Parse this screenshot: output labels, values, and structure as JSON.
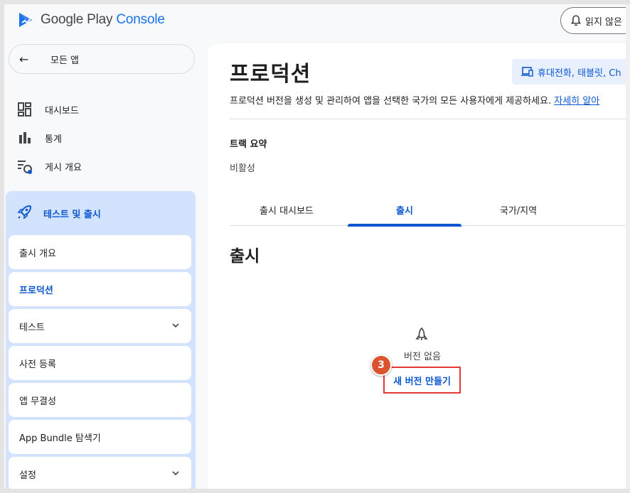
{
  "app": {
    "logo_google_play": "Google Play",
    "logo_console": "Console",
    "notifications_label": "읽지 않은"
  },
  "sidebar": {
    "back_label": "모든 앱",
    "items": [
      {
        "label": "대시보드",
        "icon": "dashboard-icon"
      },
      {
        "label": "통계",
        "icon": "bar-chart-icon"
      },
      {
        "label": "게시 개요",
        "icon": "publishing-overview-icon"
      }
    ],
    "section": {
      "label": "테스트 및 출시",
      "icon": "rocket-icon",
      "items": [
        {
          "label": "출시 개요",
          "active": false,
          "expandable": false
        },
        {
          "label": "프로덕션",
          "active": true,
          "expandable": false
        },
        {
          "label": "테스트",
          "active": false,
          "expandable": true
        },
        {
          "label": "사전 등록",
          "active": false,
          "expandable": false
        },
        {
          "label": "앱 무결성",
          "active": false,
          "expandable": false
        },
        {
          "label": "App Bundle 탐색기",
          "active": false,
          "expandable": false
        },
        {
          "label": "설정",
          "active": false,
          "expandable": true
        }
      ]
    }
  },
  "main": {
    "title": "프로덕션",
    "device_chip": "휴대전화, 태블릿, Ch",
    "description": "프로덕션 버전을 생성 및 관리하여 앱을 선택한 국가의 모든 사용자에게 제공하세요.",
    "learn_more": "자세히 알아",
    "track_summary_title": "트랙 요약",
    "track_status": "비활성",
    "tabs": [
      {
        "label": "출시 대시보드",
        "active": false
      },
      {
        "label": "출시",
        "active": true
      },
      {
        "label": "국가/지역",
        "active": false
      }
    ],
    "release_heading": "출시",
    "empty_state": "버전 없음",
    "new_release_button": "새 버전 만들기",
    "step_badge": "3"
  },
  "colors": {
    "accent": "#0b57d0",
    "section_bg": "#d3e3fd",
    "highlight_border": "#e53935",
    "badge_bg": "#d9542f"
  }
}
